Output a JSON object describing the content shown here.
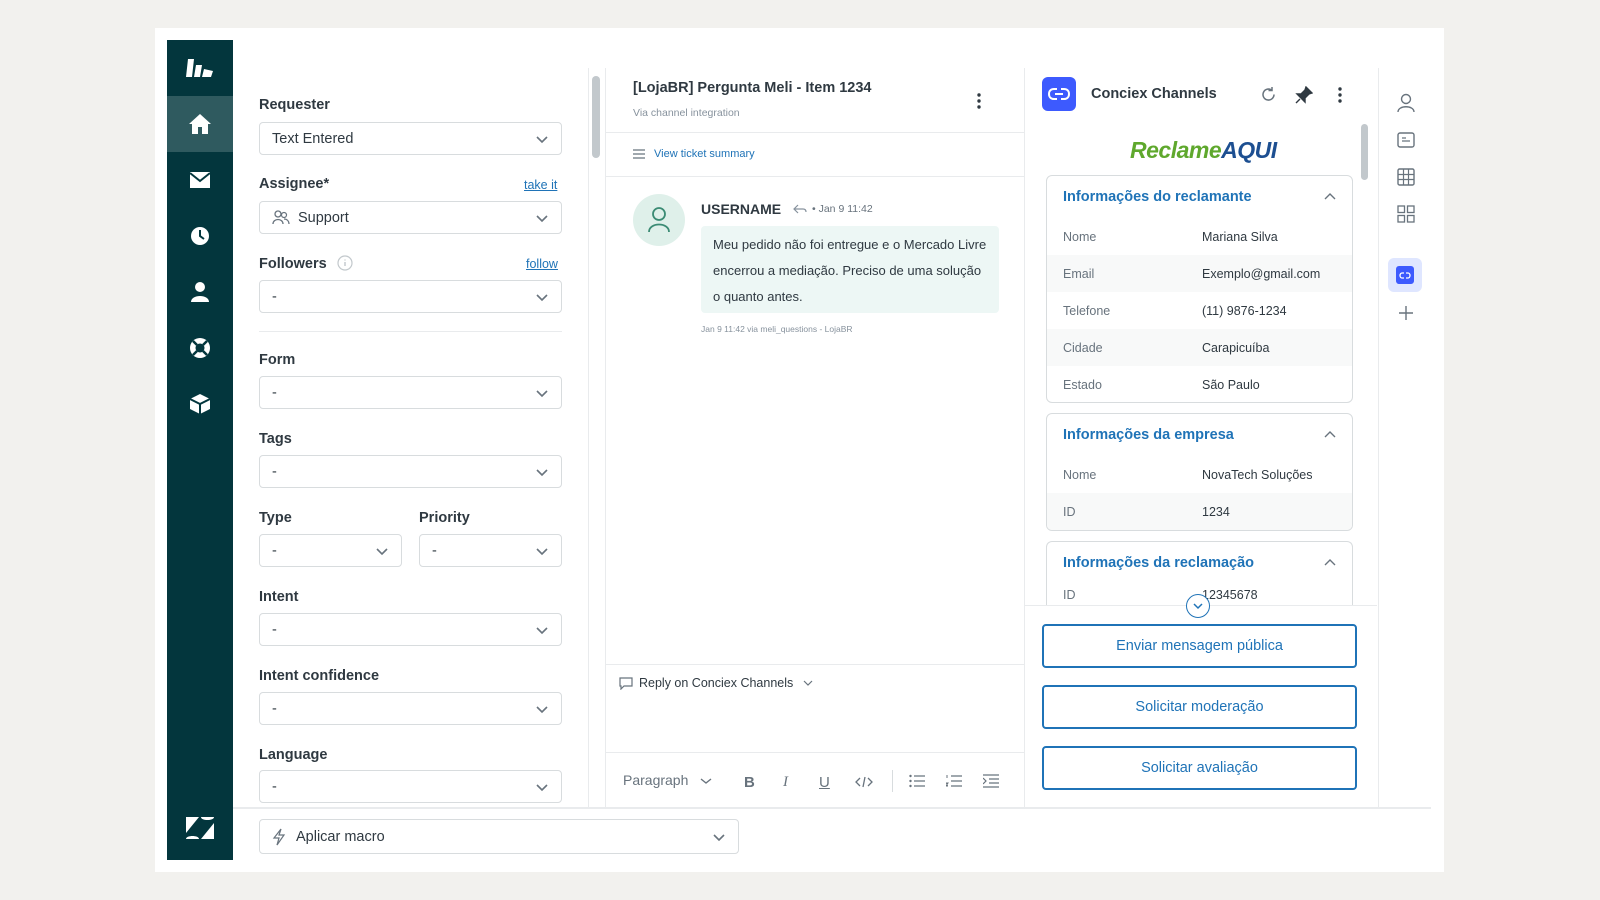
{
  "nav": {
    "items": [
      {
        "icon": "home-icon",
        "active": true
      },
      {
        "icon": "mail-icon"
      },
      {
        "icon": "clock-icon"
      },
      {
        "icon": "user-icon"
      },
      {
        "icon": "lifebuoy-icon"
      },
      {
        "icon": "cube-icon"
      }
    ],
    "bottom_logo": "zendesk-logo-icon"
  },
  "properties": {
    "requester": {
      "label": "Requester",
      "value": "Text Entered"
    },
    "assignee": {
      "label": "Assignee*",
      "link": "take it",
      "value": "Support"
    },
    "followers": {
      "label": "Followers",
      "link": "follow",
      "value": "-"
    },
    "form": {
      "label": "Form",
      "value": "-"
    },
    "tags": {
      "label": "Tags",
      "value": "-"
    },
    "type": {
      "label": "Type",
      "value": "-"
    },
    "priority": {
      "label": "Priority",
      "value": "-"
    },
    "intent": {
      "label": "Intent",
      "value": "-"
    },
    "intent_confidence": {
      "label": "Intent confidence",
      "value": "-"
    },
    "language": {
      "label": "Language",
      "value": "-"
    }
  },
  "conversation": {
    "title": "[LojaBR] Pergunta Meli - Item 1234",
    "subtitle": "Via channel integration",
    "summary_link": "View ticket summary",
    "message": {
      "author": "USERNAME",
      "time": "Jan 9 11:42",
      "body": "Meu pedido não foi entregue e o Mercado Livre encerrou a mediação. Preciso de uma solução o quanto antes.",
      "meta": "Jan 9 11:42 via meli_questions - LojaBR"
    },
    "reply_channel": "Reply on Conciex Channels",
    "toolbar": {
      "paragraph": "Paragraph"
    }
  },
  "app_panel": {
    "title": "Conciex Channels",
    "brand_reclame": "Reclame",
    "brand_aqui": "AQUI",
    "reclamante": {
      "title": "Informações do reclamante",
      "rows": [
        {
          "k": "Nome",
          "v": "Mariana Silva"
        },
        {
          "k": "Email",
          "v": "Exemplo@gmail.com"
        },
        {
          "k": "Telefone",
          "v": "(11) 9876-1234"
        },
        {
          "k": "Cidade",
          "v": "Carapicuíba"
        },
        {
          "k": "Estado",
          "v": "São Paulo"
        }
      ]
    },
    "empresa": {
      "title": "Informações da empresa",
      "rows": [
        {
          "k": "Nome",
          "v": "NovaTech Soluções"
        },
        {
          "k": "ID",
          "v": "1234"
        }
      ]
    },
    "reclamacao": {
      "title": "Informações da reclamação",
      "rows": [
        {
          "k": "ID",
          "v": "12345678"
        }
      ]
    },
    "buttons": {
      "public_message": "Enviar mensagem pública",
      "moderation": "Solicitar moderação",
      "evaluation": "Solicitar avaliação"
    }
  },
  "bottom": {
    "macro_placeholder": "Aplicar macro"
  },
  "colors": {
    "nav_bg": "#03363d",
    "accent": "#1f73b7",
    "bubble_bg": "#edf7f5",
    "reclame_green": "#5fa82d"
  }
}
